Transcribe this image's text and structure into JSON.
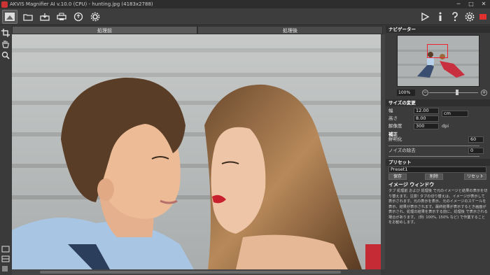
{
  "titlebar": {
    "title": "AKVIS Magnifier AI v.10.0 (CPU) - hunting.jpg (4183x2788)",
    "minimize": "─",
    "maximize": "□",
    "close": "✕"
  },
  "toolbar": {
    "left_icons": [
      "logo-icon",
      "open-icon",
      "save-icon",
      "print-icon",
      "share-icon",
      "settings-gear-icon"
    ],
    "right_icons": [
      "run-icon",
      "info-icon",
      "help-icon",
      "preferences-icon",
      "batch-icon"
    ]
  },
  "left_tools": [
    "crop-icon",
    "hand-icon",
    "zoom-icon"
  ],
  "tabs": [
    {
      "label": "処理前",
      "active": true
    },
    {
      "label": "処理後",
      "active": false
    }
  ],
  "panel": {
    "navigator_title": "ナビゲーター",
    "zoom_value": "100%",
    "size_title": "サイズの変更",
    "width_label": "幅",
    "width_value": "12.00",
    "height_label": "高さ",
    "height_value": "8.00",
    "unit_value": "cm",
    "resolution_label": "解像度",
    "resolution_value": "300",
    "resolution_unit": "dpi",
    "adjust_title": "補正",
    "sharpness_label": "鮮明化",
    "sharpness_value": "60",
    "noise_label": "ノイズの除去",
    "noise_value": "0",
    "preset_title": "プリセット",
    "preset_value": "Preset1",
    "save_label": "保存",
    "delete_label": "削除",
    "reset_label": "リセット",
    "help_title": "イメージ ウィンドウ",
    "help_text": "タブ 処理前 および 処理後 で元のイメージと結果の表示を切り替えます。注意! タブの切り替えは、イメージが表示して表示されます。元の表示を表示、元のイメージのスケールを表示、結果が表示されます。最終結果が表示するとき画面が表示され、処理の結果を表示する前に、処理後 で表示される場合があります。 (例: 100%, 150% など) で作業することをお勧めします。"
  },
  "colors": {
    "accent_red": "#e03030",
    "panel_bg": "#3b3b3b"
  }
}
